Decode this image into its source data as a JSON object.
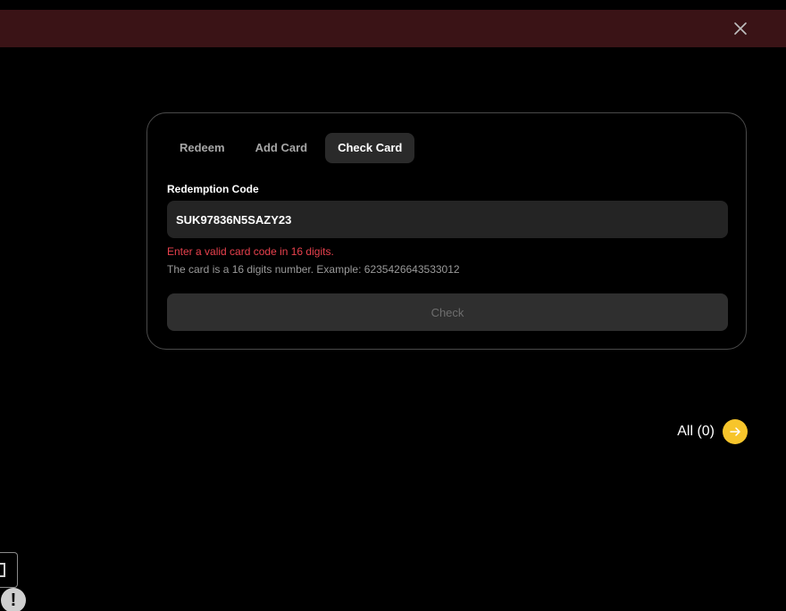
{
  "banner": {
    "close_icon": "close-icon"
  },
  "tabs": [
    {
      "label": "Redeem",
      "active": false
    },
    {
      "label": "Add Card",
      "active": false
    },
    {
      "label": "Check Card",
      "active": true
    }
  ],
  "form": {
    "label": "Redemption Code",
    "code_value": "SUK97836N5SAZY23",
    "error": "Enter a valid card code in 16 digits.",
    "hint": "The card is a 16 digits number. Example: 6235426643533012",
    "button_label": "Check"
  },
  "all_link": {
    "label": "All (0)",
    "icon": "arrow-right-icon"
  },
  "alert_badge": {
    "symbol": "!"
  },
  "colors": {
    "banner_bg": "#3a1316",
    "error": "#e8414d",
    "accent_yellow": "#f7c52b",
    "card_border": "#4a4a4a"
  }
}
